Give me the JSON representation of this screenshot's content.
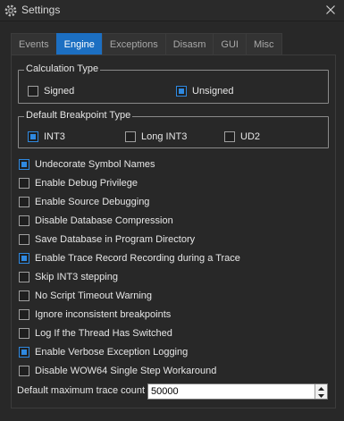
{
  "window": {
    "title": "Settings",
    "app_icon": "gear-icon",
    "close_icon": "close-icon"
  },
  "tabs": [
    {
      "label": "Events",
      "active": false
    },
    {
      "label": "Engine",
      "active": true
    },
    {
      "label": "Exceptions",
      "active": false
    },
    {
      "label": "Disasm",
      "active": false
    },
    {
      "label": "GUI",
      "active": false
    },
    {
      "label": "Misc",
      "active": false
    }
  ],
  "calculation_type": {
    "title": "Calculation Type",
    "options": [
      {
        "label": "Signed",
        "checked": false
      },
      {
        "label": "Unsigned",
        "checked": true
      }
    ]
  },
  "breakpoint_type": {
    "title": "Default Breakpoint Type",
    "options": [
      {
        "label": "INT3",
        "checked": true
      },
      {
        "label": "Long INT3",
        "checked": false
      },
      {
        "label": "UD2",
        "checked": false
      }
    ]
  },
  "checkboxes": [
    {
      "label": "Undecorate Symbol Names",
      "checked": true
    },
    {
      "label": "Enable Debug Privilege",
      "checked": false
    },
    {
      "label": "Enable Source Debugging",
      "checked": false
    },
    {
      "label": "Disable Database Compression",
      "checked": false
    },
    {
      "label": "Save Database in Program Directory",
      "checked": false
    },
    {
      "label": "Enable Trace Record Recording during a Trace",
      "checked": true
    },
    {
      "label": "Skip INT3 stepping",
      "checked": false
    },
    {
      "label": "No Script Timeout Warning",
      "checked": false
    },
    {
      "label": "Ignore inconsistent breakpoints",
      "checked": false
    },
    {
      "label": "Log If the Thread Has Switched",
      "checked": false
    },
    {
      "label": "Enable Verbose Exception Logging",
      "checked": true
    },
    {
      "label": "Disable WOW64 Single Step Workaround",
      "checked": false
    }
  ],
  "trace_count": {
    "label": "Default maximum trace count",
    "value": "50000"
  },
  "colors": {
    "accent": "#2f89e0",
    "tab_active": "#1c6fc2",
    "background": "#282828"
  }
}
